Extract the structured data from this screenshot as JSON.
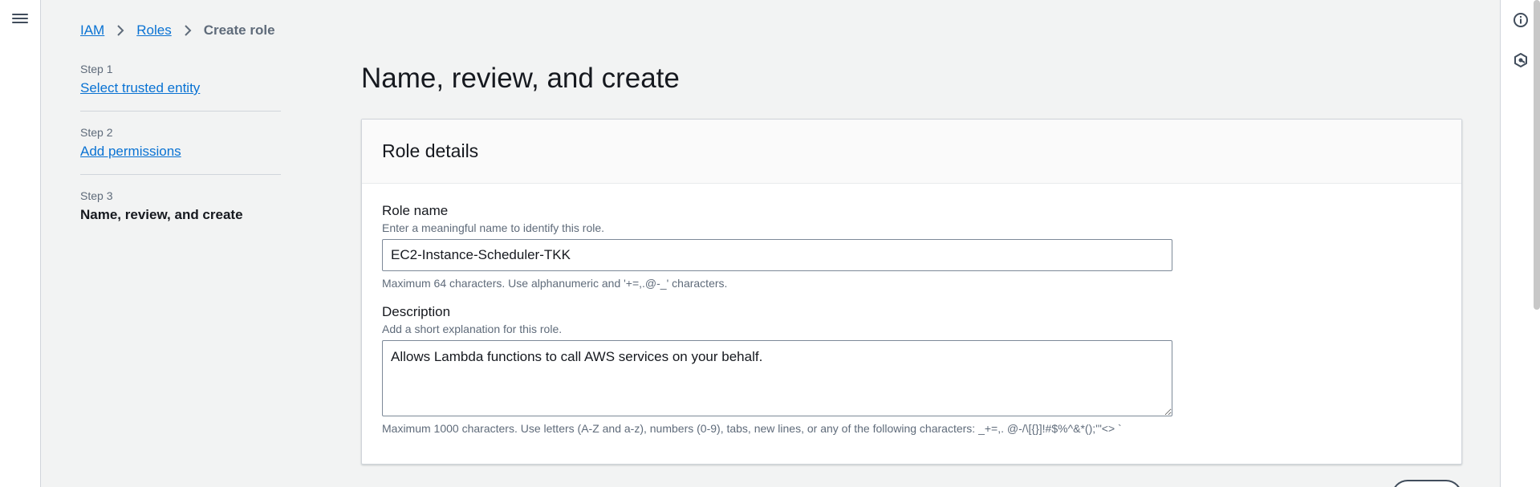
{
  "breadcrumb": {
    "items": [
      "IAM",
      "Roles"
    ],
    "current": "Create role"
  },
  "steps": [
    {
      "label": "Step 1",
      "title": "Select trusted entity"
    },
    {
      "label": "Step 2",
      "title": "Add permissions"
    },
    {
      "label": "Step 3",
      "title": "Name, review, and create"
    }
  ],
  "page": {
    "title": "Name, review, and create"
  },
  "role_details": {
    "title": "Role details",
    "role_name": {
      "label": "Role name",
      "description": "Enter a meaningful name to identify this role.",
      "value": "EC2-Instance-Scheduler-TKK",
      "hint": "Maximum 64 characters. Use alphanumeric and '+=,.@-_' characters."
    },
    "description": {
      "label": "Description",
      "description": "Add a short explanation for this role.",
      "value": "Allows Lambda functions to call AWS services on your behalf.",
      "hint": "Maximum 1000 characters. Use letters (A-Z and a-z), numbers (0-9), tabs, new lines, or any of the following characters: _+=,. @-/\\[{}]!#$%^&*();'\"<> `"
    }
  },
  "icons": {
    "menu": "hamburger-menu-icon",
    "info": "info-icon",
    "settings": "hexagon-settings-icon"
  },
  "colors": {
    "link": "#0972d3",
    "text": "#16191f",
    "muted": "#5f6b7a",
    "background": "#f2f3f3"
  }
}
